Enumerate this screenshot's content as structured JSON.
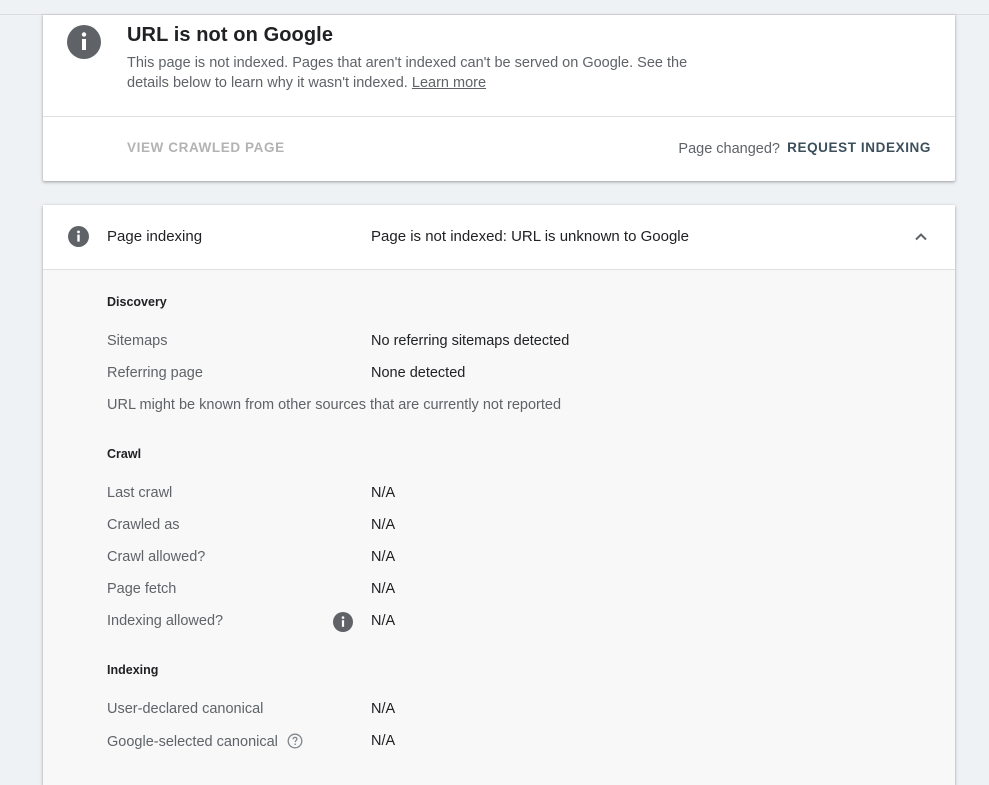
{
  "status": {
    "title": "URL is not on Google",
    "description": "This page is not indexed. Pages that aren't indexed can't be served on Google. See the details below to learn why it wasn't indexed.",
    "learn_more": "Learn more",
    "view_crawled": "VIEW CRAWLED PAGE",
    "page_changed": "Page changed?",
    "request_indexing": "REQUEST INDEXING"
  },
  "detail": {
    "title": "Page indexing",
    "status": "Page is not indexed: URL is unknown to Google",
    "discovery": {
      "title": "Discovery",
      "rows": [
        {
          "label": "Sitemaps",
          "value": "No referring sitemaps detected"
        },
        {
          "label": "Referring page",
          "value": "None detected"
        }
      ],
      "note": "URL might be known from other sources that are currently not reported"
    },
    "crawl": {
      "title": "Crawl",
      "rows": [
        {
          "label": "Last crawl",
          "value": "N/A"
        },
        {
          "label": "Crawled as",
          "value": "N/A"
        },
        {
          "label": "Crawl allowed?",
          "value": "N/A"
        },
        {
          "label": "Page fetch",
          "value": "N/A"
        },
        {
          "label": "Indexing allowed?",
          "value": "N/A"
        }
      ]
    },
    "indexing": {
      "title": "Indexing",
      "rows": [
        {
          "label": "User-declared canonical",
          "value": "N/A"
        },
        {
          "label": "Google-selected canonical",
          "value": "N/A"
        }
      ]
    }
  },
  "icons": {
    "status": "info-icon",
    "detail": "info-icon",
    "indexing_allowed": "info-icon",
    "google_canonical_help": "help-circle-icon",
    "collapse": "chevron-up-icon"
  },
  "colors": {
    "background": "#eff2f5",
    "icon_grey": "#5f6368",
    "action_text": "#3c4f5c",
    "disabled_text": "#b3b3b3"
  }
}
